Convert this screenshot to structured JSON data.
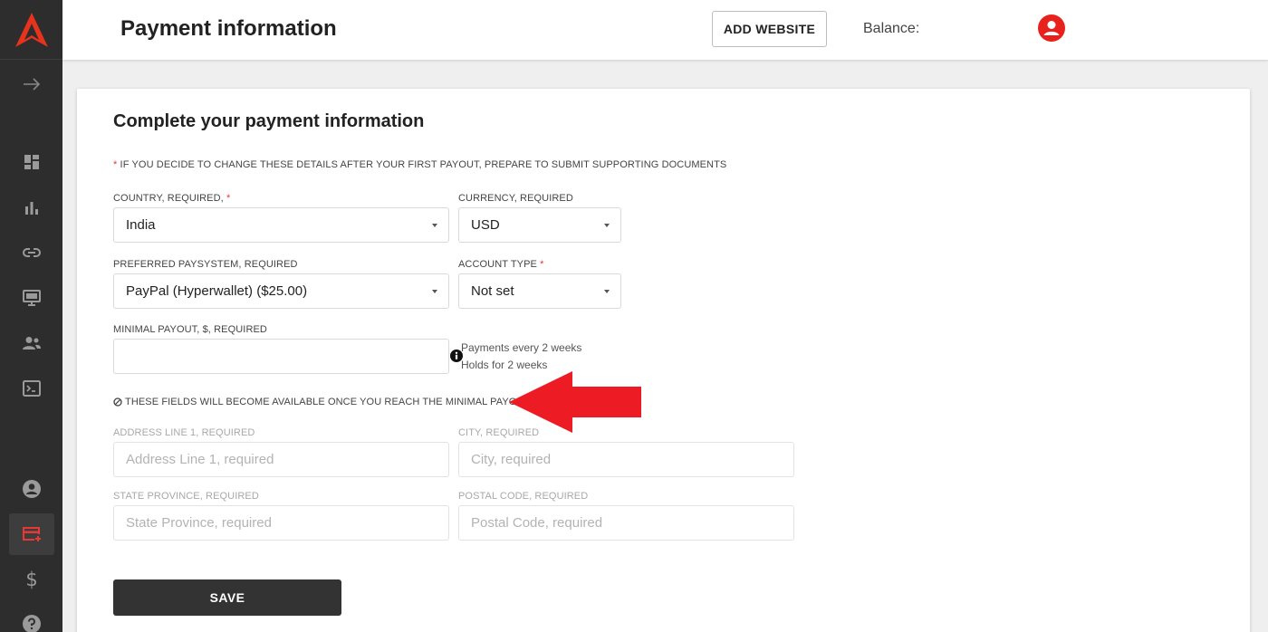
{
  "header": {
    "title": "Payment information",
    "add_website_label": "ADD WEBSITE",
    "balance_label": "Balance:"
  },
  "sidebar": {
    "items": [
      {
        "icon": "arrow-right-icon"
      },
      {
        "icon": "dashboard-icon"
      },
      {
        "icon": "bar-chart-icon"
      },
      {
        "icon": "link-icon"
      },
      {
        "icon": "monitor-icon"
      },
      {
        "icon": "users-icon"
      },
      {
        "icon": "terminal-icon"
      },
      {
        "icon": "account-icon"
      },
      {
        "icon": "payment-card-icon",
        "active": true
      },
      {
        "icon": "dollar-icon"
      },
      {
        "icon": "help-icon"
      }
    ]
  },
  "form": {
    "title": "Complete your payment information",
    "notice_star": "*",
    "notice": "IF YOU DECIDE TO CHANGE THESE DETAILS AFTER YOUR FIRST PAYOUT, PREPARE TO SUBMIT SUPPORTING DOCUMENTS",
    "country": {
      "label": "COUNTRY, REQUIRED,",
      "star": "*",
      "value": "India"
    },
    "currency": {
      "label": "CURRENCY, REQUIRED",
      "value": "USD"
    },
    "paysystem": {
      "label": "PREFERRED PAYSYSTEM, REQUIRED",
      "value": "PayPal (Hyperwallet) ($25.00)"
    },
    "account_type": {
      "label": "ACCOUNT TYPE",
      "star": "*",
      "value": "Not set"
    },
    "minimal_payout": {
      "label": "MINIMAL PAYOUT, $, REQUIRED",
      "value": ""
    },
    "payout_hint_1": "Payments every 2 weeks",
    "payout_hint_2": "Holds for 2 weeks",
    "disabled_note": "THESE FIELDS WILL BECOME AVAILABLE ONCE YOU REACH THE MINIMAL PAYOUT",
    "address1": {
      "label": "ADDRESS LINE 1, REQUIRED",
      "placeholder": "Address Line 1, required"
    },
    "city": {
      "label": "CITY, REQUIRED",
      "placeholder": "City, required"
    },
    "state": {
      "label": "STATE PROVINCE, REQUIRED",
      "placeholder": "State Province, required"
    },
    "postal": {
      "label": "POSTAL CODE, REQUIRED",
      "placeholder": "Postal Code, required"
    },
    "save_label": "SAVE"
  },
  "colors": {
    "accent": "#e53935",
    "sidebar_bg": "#2d2d2d",
    "annotation_arrow": "#ed1c24"
  }
}
